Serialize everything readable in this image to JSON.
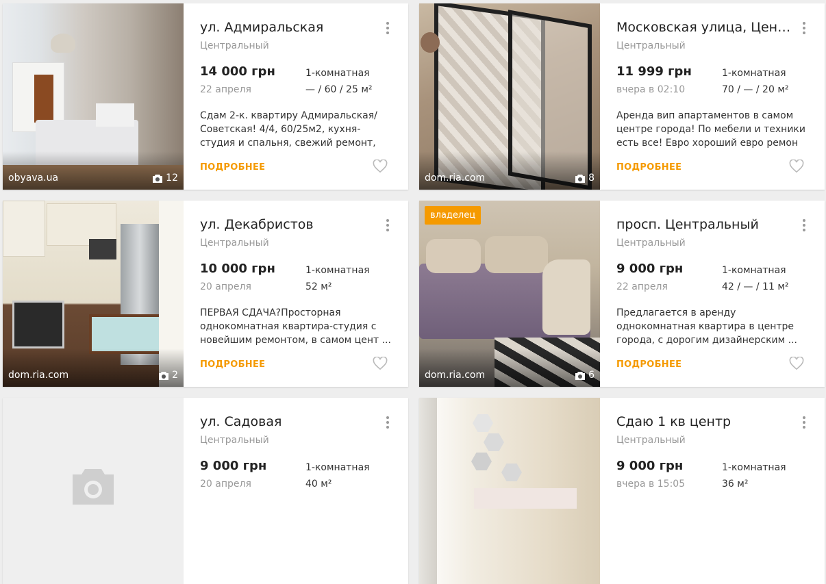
{
  "listings": [
    {
      "title": "ул. Адмиральская",
      "district": "Центральный",
      "price": "14 000 грн",
      "date": "22 апреля",
      "rooms": "1-комнатная",
      "area": "— / 60 / 25 м²",
      "description": "Сдам 2-к. квартиру Адмиральская/ Советская! 4/4, 60/25м2, кухня-студия и спальня, свежий ремонт, мебель ...",
      "more": "ПОДРОБНЕЕ",
      "source": "obyava.ua",
      "photos": "12"
    },
    {
      "title": "Московская улица, Цент...",
      "district": "Центральный",
      "price": "11 999 грн",
      "date": "вчера в 02:10",
      "rooms": "1-комнатная",
      "area": "70 / — / 20 м²",
      "description": "Аренда вип апартаментов в самом центре города! По мебели и техники есть все! Евро хороший евро ремон ...",
      "more": "ПОДРОБНЕЕ",
      "source": "dom.ria.com",
      "photos": "8"
    },
    {
      "title": "ул. Декабристов",
      "district": "Центральный",
      "price": "10 000 грн",
      "date": "20 апреля",
      "rooms": "1-комнатная",
      "area": "52 м²",
      "description": "ПЕРВАЯ СДАЧА?Просторная однокомнатная квартира-студия с новейшим ремонтом, в самом цент ...",
      "more": "ПОДРОБНЕЕ",
      "source": "dom.ria.com",
      "photos": "2"
    },
    {
      "title": "просп. Центральный",
      "district": "Центральный",
      "price": "9 000 грн",
      "date": "22 апреля",
      "rooms": "1-комнатная",
      "area": "42 / — / 11 м²",
      "description": "Предлагается в аренду однокомнатная квартира в центре города, с дорогим дизайнерским ...",
      "more": "ПОДРОБНЕЕ",
      "source": "dom.ria.com",
      "photos": "6",
      "badge": "владелец"
    },
    {
      "title": "ул. Садовая",
      "district": "Центральный",
      "price": "9 000 грн",
      "date": "20 апреля",
      "rooms": "1-комнатная",
      "area": "40 м²"
    },
    {
      "title": "Сдаю 1 кв центр",
      "district": "Центральный",
      "price": "9 000 грн",
      "date": "вчера в 15:05",
      "rooms": "1-комнатная",
      "area": "36 м²"
    }
  ],
  "colors": {
    "accent": "#f59a00",
    "muted": "#999999",
    "page_bg": "#eeeeee"
  },
  "icons": {
    "menu": "vertical-dots-icon",
    "favorite": "heart-outline-icon",
    "photos": "camera-icon",
    "no_photo": "camera-placeholder-icon"
  }
}
